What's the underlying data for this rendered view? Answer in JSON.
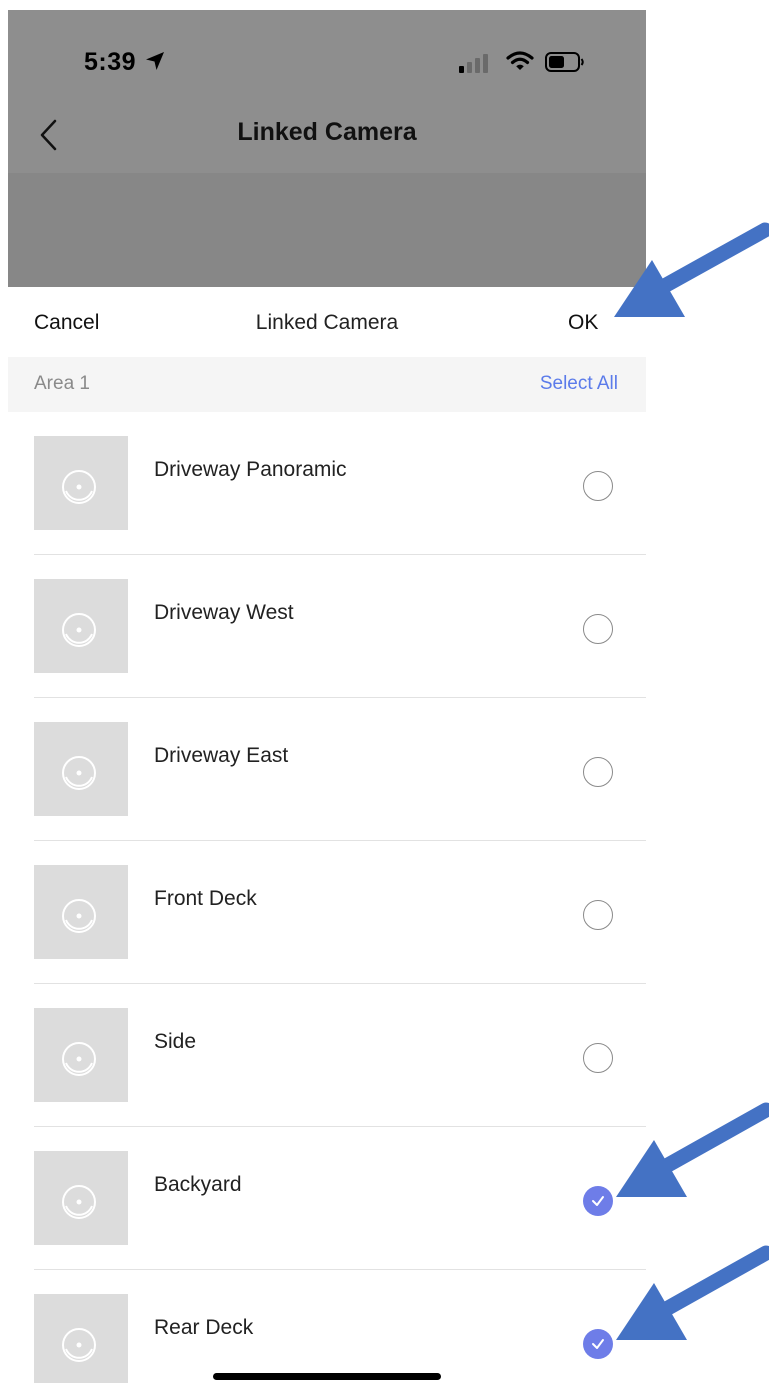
{
  "status_bar": {
    "time": "5:39"
  },
  "background_screen": {
    "title": "Linked Camera"
  },
  "sheet": {
    "cancel_label": "Cancel",
    "title": "Linked Camera",
    "ok_label": "OK"
  },
  "area": {
    "name": "Area 1",
    "select_all_label": "Select All"
  },
  "cameras": [
    {
      "name": "Driveway Panoramic",
      "selected": false
    },
    {
      "name": "Driveway West",
      "selected": false
    },
    {
      "name": "Driveway East",
      "selected": false
    },
    {
      "name": "Front Deck",
      "selected": false
    },
    {
      "name": "Side",
      "selected": false
    },
    {
      "name": "Backyard",
      "selected": true
    },
    {
      "name": "Rear Deck",
      "selected": true
    }
  ],
  "colors": {
    "accent": "#6e7de8",
    "link": "#5b7bea",
    "annotation_arrow": "#4472c4"
  }
}
